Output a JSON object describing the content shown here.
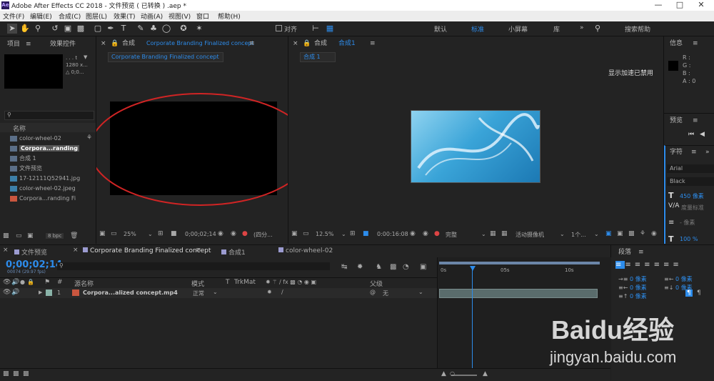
{
  "title_bar": {
    "logo": "Ae",
    "title": "Adobe After Effects CC 2018 - 文件预览 ( 已转换 ) .aep *"
  },
  "menu": [
    "文件(F)",
    "编辑(E)",
    "合成(C)",
    "图层(L)",
    "效果(T)",
    "动画(A)",
    "视图(V)",
    "窗口",
    "帮助(H)"
  ],
  "toolbar": {
    "snap_label": "对齐",
    "workspaces": [
      "默认",
      "标准",
      "小屏幕",
      "库"
    ],
    "active_workspace": "标准",
    "search_placeholder": "搜索帮助"
  },
  "project_panel": {
    "tab": "项目",
    "tab2": "效果控件",
    "thumb_info": [
      ". . . t",
      "1280 x...",
      "△ 0;0..."
    ],
    "name_col": "名称",
    "items": [
      {
        "name": "color-wheel-02",
        "type": "comp"
      },
      {
        "name": "Corpora...randing",
        "type": "comp",
        "selected": true
      },
      {
        "name": "合成 1",
        "type": "comp"
      },
      {
        "name": "文件预览",
        "type": "comp"
      },
      {
        "name": "17-12111Q52941.jpg",
        "type": "image"
      },
      {
        "name": "color-wheel-02.jpeg",
        "type": "image"
      },
      {
        "name": "Corpora...randing  Fi",
        "type": "video"
      }
    ],
    "bpc": "8 bpc"
  },
  "comp_left": {
    "header_prefix": "合成",
    "header_name": "Corporate Branding  Finalized concept",
    "tab_label": "Corporate Branding  Finalized concept",
    "zoom": "25%",
    "timecode": "0;00;02;14",
    "resolution": "(四分..."
  },
  "comp_right": {
    "header_prefix": "合成",
    "header_name": "合成1",
    "tab_label": "合成 1",
    "notice": "显示加速已禁用",
    "zoom": "12.5%",
    "timecode": "0:00:16:08",
    "quality": "完整",
    "camera": "活动摄像机",
    "views": "1个..."
  },
  "info_panel": {
    "title": "信息",
    "rgba": [
      "R :",
      "G :",
      "B :",
      "A : 0"
    ]
  },
  "preview_panel": {
    "title": "预览"
  },
  "character_panel": {
    "title": "字符",
    "font": "Arial",
    "style": "Black",
    "size": "450 像素",
    "leading": "- 像素",
    "kerning_label": "度量标准",
    "scale": "100 %"
  },
  "paragraph_panel": {
    "title": "段落",
    "values": [
      "0 像素",
      "0 像素",
      "0 像素",
      "0 像素",
      "0 像素"
    ]
  },
  "timeline": {
    "tabs": [
      "文件预览",
      "Corporate Branding  Finalized concept",
      "合成1",
      "color-wheel-02"
    ],
    "active_tab": 1,
    "timecode": "0;00;02;14",
    "frame_info": "00074 (29.97 fps)",
    "columns": {
      "num": "#",
      "source": "源名称",
      "mode": "模式",
      "t": "T",
      "trkmat": "TrkMat",
      "parent": "父级"
    },
    "layer": {
      "index": "1",
      "name": "Corpora...alized concept.mp4",
      "mode": "正常",
      "parent": "无"
    },
    "ruler": [
      "0s",
      "05s",
      "10s"
    ],
    "playhead_seconds": 2.47
  },
  "watermark": {
    "brand": "Baidu经验",
    "url": "jingyan.baidu.com"
  }
}
